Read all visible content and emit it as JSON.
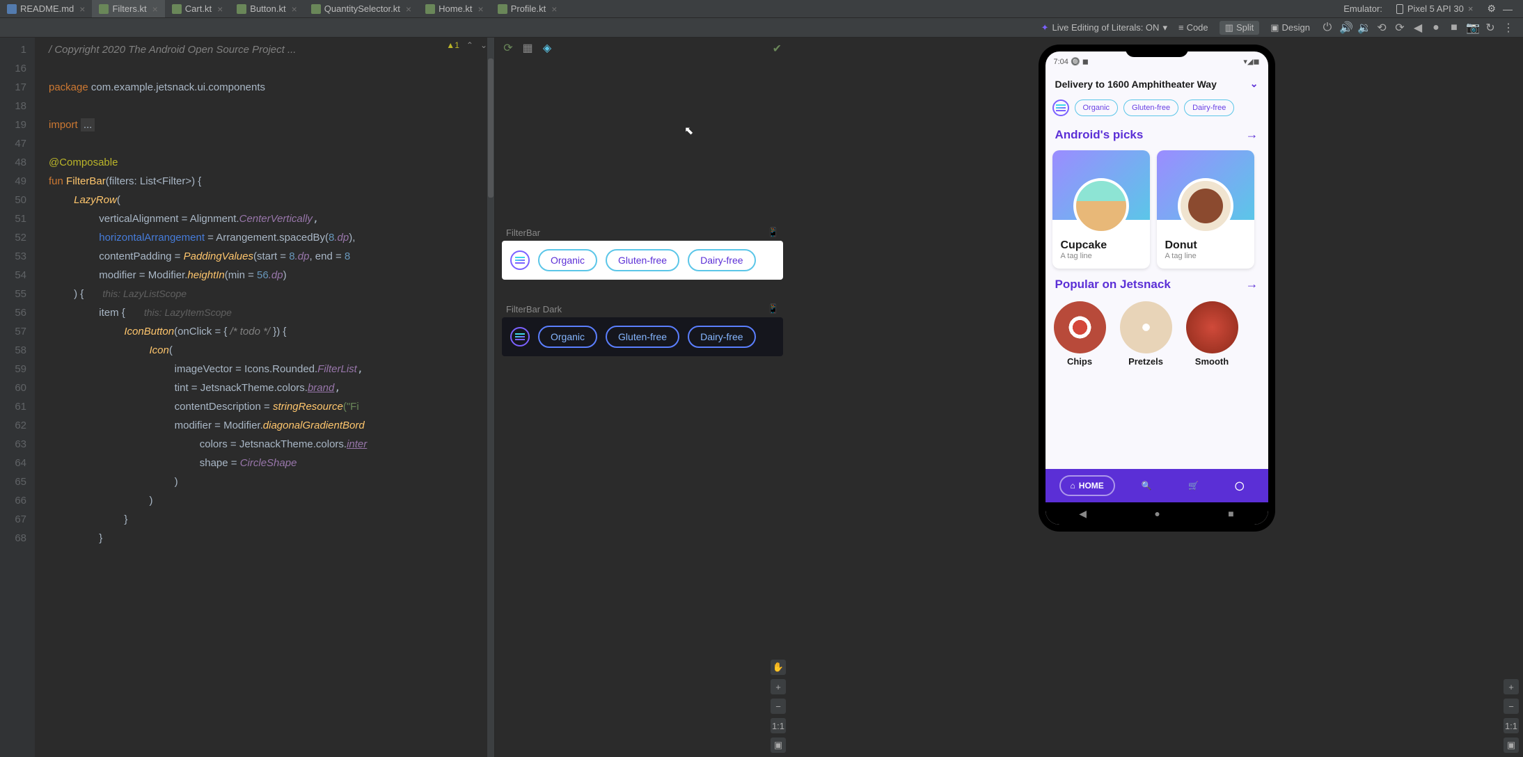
{
  "tabs": [
    {
      "label": "README.md",
      "icon": "md"
    },
    {
      "label": "Filters.kt",
      "active": true
    },
    {
      "label": "Cart.kt"
    },
    {
      "label": "Button.kt"
    },
    {
      "label": "QuantitySelector.kt"
    },
    {
      "label": "Home.kt"
    },
    {
      "label": "Profile.kt"
    }
  ],
  "emulator_label": "Emulator:",
  "device": "Pixel 5 API 30",
  "toolbar": {
    "live_edit": "Live Editing of Literals: ON",
    "modes": {
      "code": "Code",
      "split": "Split",
      "design": "Design"
    }
  },
  "editor": {
    "line_numbers": [
      1,
      16,
      17,
      18,
      19,
      47,
      48,
      49,
      50,
      51,
      52,
      53,
      54,
      55,
      56,
      57,
      58,
      59,
      60,
      61,
      62,
      63,
      64,
      65,
      66,
      67,
      68
    ],
    "badge_text": "1",
    "line1_a": "/",
    "line1_b": " Copyright 2020 The Android Open Source Project ...",
    "package_kw": "package ",
    "package_name": "com.example.jetsnack.ui.components",
    "import_kw": "import ",
    "import_rest": "...",
    "composable": "@Composable",
    "fun_kw": "fun ",
    "filterbar": "FilterBar",
    "filterbar_sig": "(filters: List<Filter>) {",
    "lazyrow": "LazyRow",
    "lazyrow_paren": "(",
    "va": "verticalAlignment = Alignment.",
    "va_v": "CenterVertically",
    "ha": "horizontalArrangement",
    "ha_v": " = Arrangement.spacedBy(",
    "ha_num": "8",
    "ha_dp": ".dp",
    "ha_end": "),",
    "cp": "contentPadding = ",
    "cp_fn": "PaddingValues",
    "cp_start": "(start = ",
    "cp_n1": "8",
    "cp_dp1": ".dp",
    "cp_end1": ", end = ",
    "cp_n2": "8",
    "mod": "modifier = Modifier.",
    "mod_fn": "heightIn",
    "mod_arg": "(min = ",
    "mod_n": "56",
    "mod_dp": ".dp",
    "mod_end": ")",
    "brace": ") {",
    "hint1": "this: LazyListScope",
    "item": "item",
    "item_brace": " {",
    "hint2": "this: LazyItemScope",
    "iconbtn": "IconButton",
    "iconbtn_arg": "(onClick = { ",
    "todo": "/* todo */",
    "iconbtn_end": " }) {",
    "icon": "Icon",
    "icon_paren": "(",
    "iv": "imageVector = Icons.Rounded.",
    "iv_v": "FilterList",
    "tint": "tint = JetsnackTheme.colors.",
    "tint_v": "brand",
    "cd": "contentDescription = ",
    "cd_fn": "stringResource",
    "cd_str": "(\"Fi",
    "mod2": "modifier = Modifier.",
    "mod2_fn": "diagonalGradientBord",
    "colors": "colors = JetsnackTheme.colors.",
    "colors_v": "inter",
    "shape": "shape = ",
    "shape_v": "CircleShape",
    "close1": ")",
    "close2": ")",
    "close3": "}",
    "close4": "}"
  },
  "preview": {
    "light_title": "FilterBar",
    "dark_title": "FilterBar Dark",
    "chips": [
      "Organic",
      "Gluten-free",
      "Dairy-free"
    ]
  },
  "app": {
    "time": "7:04",
    "address": "Delivery to 1600 Amphitheater Way",
    "chips": [
      "Organic",
      "Gluten-free",
      "Dairy-free"
    ],
    "section1": "Android's picks",
    "cards": [
      {
        "title": "Cupcake",
        "sub": "A tag line"
      },
      {
        "title": "Donut",
        "sub": "A tag line"
      }
    ],
    "section2": "Popular on Jetsnack",
    "circles": [
      "Chips",
      "Pretzels",
      "Smooth"
    ],
    "home": "HOME"
  },
  "zoom": "1:1"
}
